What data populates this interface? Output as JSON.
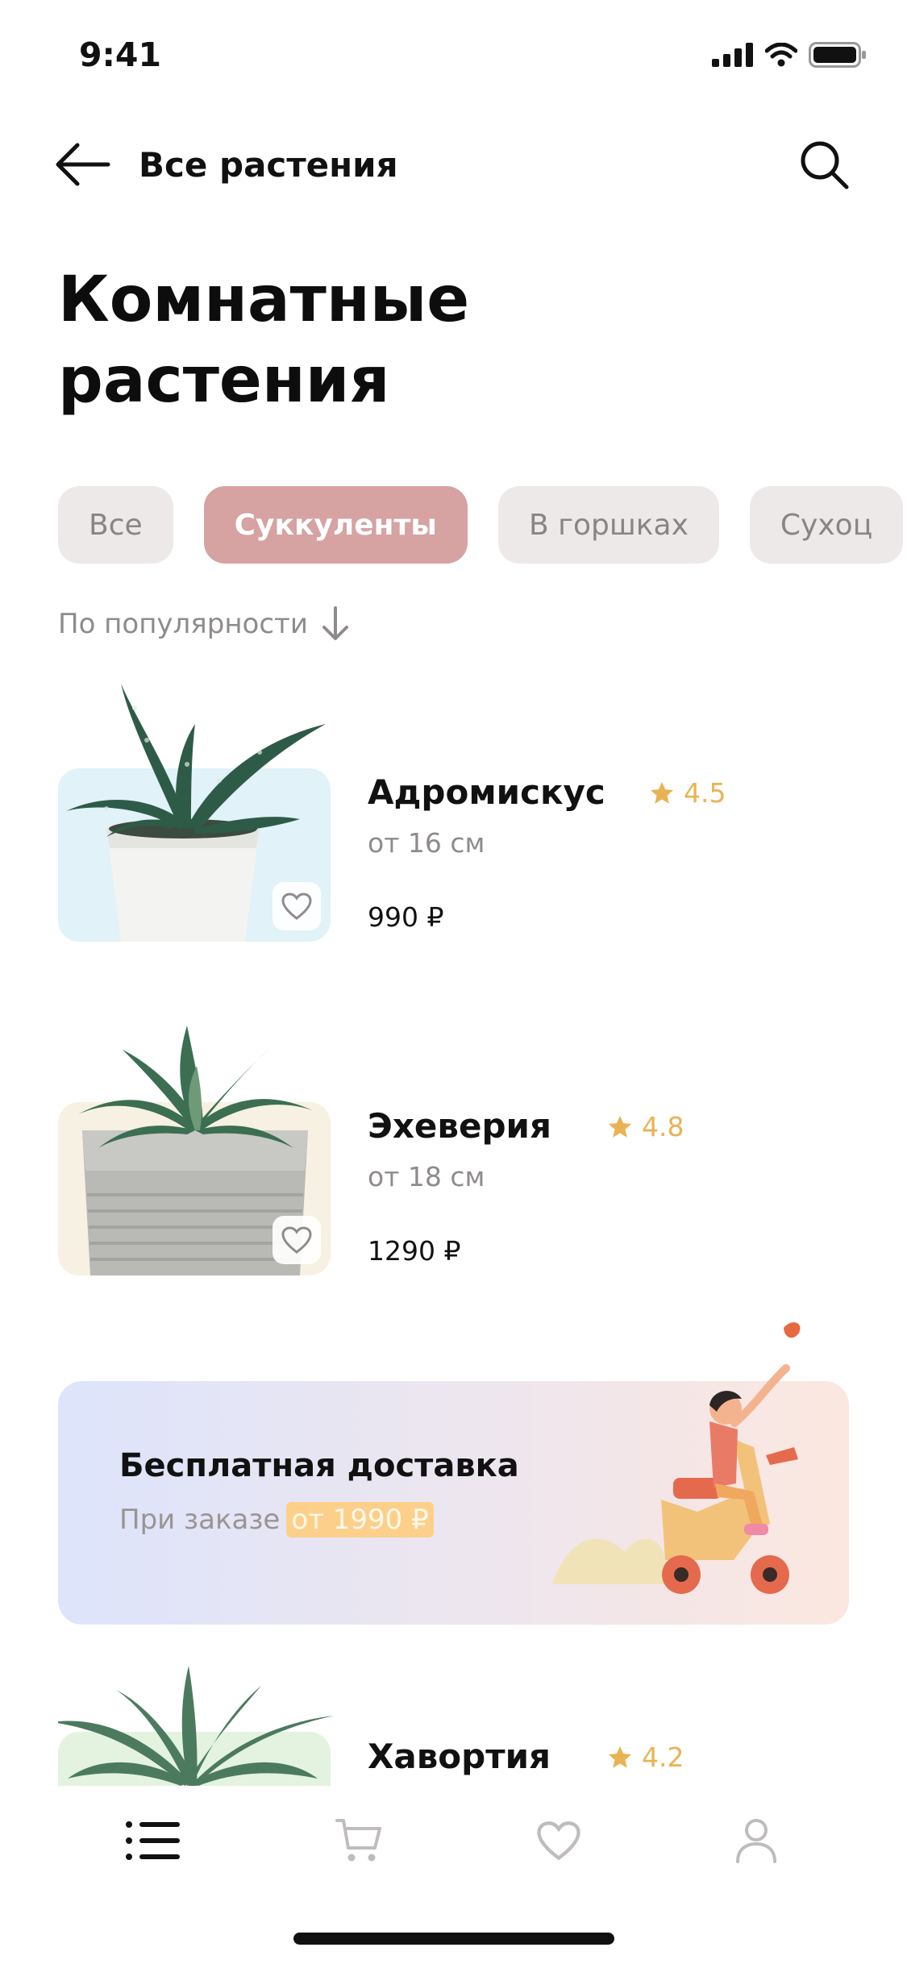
{
  "status_bar": {
    "time": "9:41",
    "icons": [
      "signal-icon",
      "wifi-icon",
      "battery-icon"
    ]
  },
  "header": {
    "title": "Все растения",
    "back_icon": "arrow-left-icon",
    "search_icon": "search-icon"
  },
  "page_title": "Комнатные растения",
  "filters": [
    {
      "label": "Все",
      "active": false
    },
    {
      "label": "Суккуленты",
      "active": true
    },
    {
      "label": "В горшках",
      "active": false
    },
    {
      "label": "Сухоц",
      "active": false
    }
  ],
  "sort": {
    "label": "По популярности",
    "icon": "arrow-down-icon"
  },
  "products": [
    {
      "name": "Адромискус",
      "rating": "4.5",
      "size": "от 16 см",
      "price": "990 ₽",
      "thumb_bg": "#e1f2f8"
    },
    {
      "name": "Эхеверия",
      "rating": "4.8",
      "size": "от 18 см",
      "price": "1290 ₽",
      "thumb_bg": "#f6f1e2"
    },
    {
      "name": "Хавортия",
      "rating": "4.2",
      "size": "",
      "price": "",
      "thumb_bg": "#e3f3df"
    }
  ],
  "promo": {
    "title": "Бесплатная доставка",
    "subtitle_prefix": "При заказе",
    "subtitle_highlight": "от 1990 ₽"
  },
  "tab_bar": {
    "tabs": [
      {
        "icon": "list-icon",
        "active": true
      },
      {
        "icon": "cart-icon",
        "active": false
      },
      {
        "icon": "heart-icon",
        "active": false
      },
      {
        "icon": "profile-icon",
        "active": false
      }
    ]
  },
  "colors": {
    "accent_chip": "#d6a2a2",
    "chip_bg": "#ede9e8",
    "rating": "#e9b354",
    "muted_text": "#8f8b8b",
    "highlight": "#fcd08a"
  }
}
